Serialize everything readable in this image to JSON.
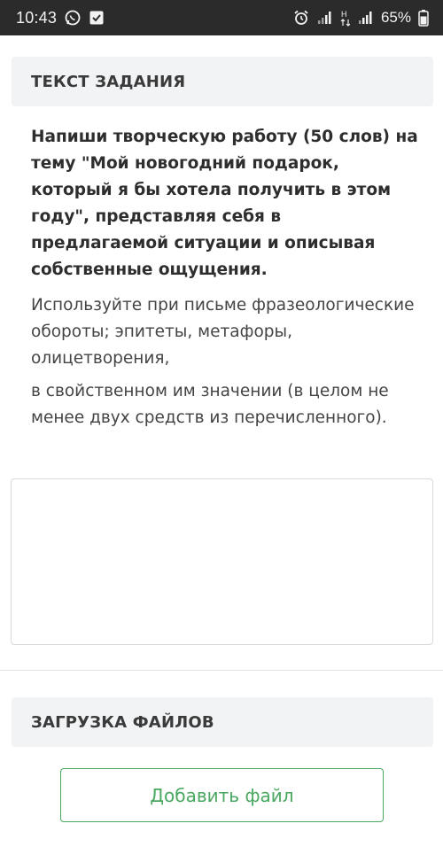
{
  "status_bar": {
    "time": "10:43",
    "battery": "65%",
    "icons": [
      "whatsapp-icon",
      "download-check-icon",
      "alarm-icon",
      "signal-icon",
      "data-arrows-icon",
      "signal-icon",
      "battery-icon"
    ]
  },
  "task": {
    "header": "ТЕКСТ ЗАДАНИЯ",
    "bold_text": "Напиши творческую работу (50 слов) на тему \"Мой новогодний подарок, который я бы хотела получить в этом году\", представляя себя в предлагаемой ситуации и описывая собственные ощущения.",
    "paragraph_1": "Используйте при письме фразеологические обороты; эпитеты, метафоры, олицетворения,",
    "paragraph_2": "в свойственном им значении (в целом не менее двух средств из перечисленного)."
  },
  "answer": {
    "value": ""
  },
  "upload": {
    "header": "ЗАГРУЗКА ФАЙЛОВ",
    "add_file_label": "Добавить файл"
  },
  "colors": {
    "accent_green": "#49a85f",
    "header_bg": "#f1f3f5",
    "status_bar_bg": "#2b2b2b"
  }
}
